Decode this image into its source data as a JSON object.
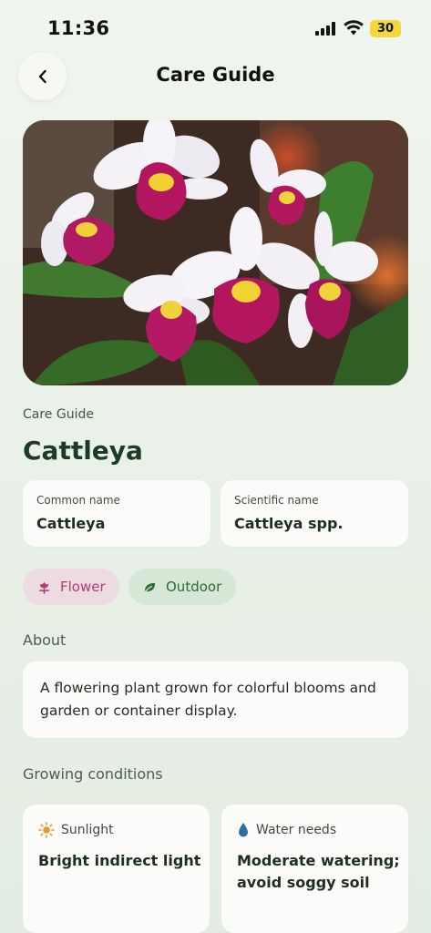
{
  "status_bar": {
    "time": "11:36",
    "battery": "30"
  },
  "header": {
    "title": "Care Guide",
    "back_icon": "chevron-left-icon"
  },
  "hero": {
    "alt": "Cattleya orchid flowers"
  },
  "plant": {
    "eyebrow": "Care Guide",
    "name": "Cattleya",
    "common_name_label": "Common name",
    "common_name": "Cattleya",
    "scientific_name_label": "Scientific name",
    "scientific_name": "Cattleya spp."
  },
  "tags": [
    {
      "label": "Flower",
      "icon": "flower-icon",
      "color": "#b33d78"
    },
    {
      "label": "Outdoor",
      "icon": "leaf-icon",
      "color": "#2f6b37"
    }
  ],
  "about": {
    "title": "About",
    "text": "A flowering plant grown for colorful blooms and garden or container display."
  },
  "growing": {
    "title": "Growing conditions",
    "items": [
      {
        "label": "Sunlight",
        "icon": "sun-icon",
        "value": "Bright indirect light"
      },
      {
        "label": "Water needs",
        "icon": "water-drop-icon",
        "value": "Moderate watering; avoid soggy soil"
      }
    ]
  }
}
